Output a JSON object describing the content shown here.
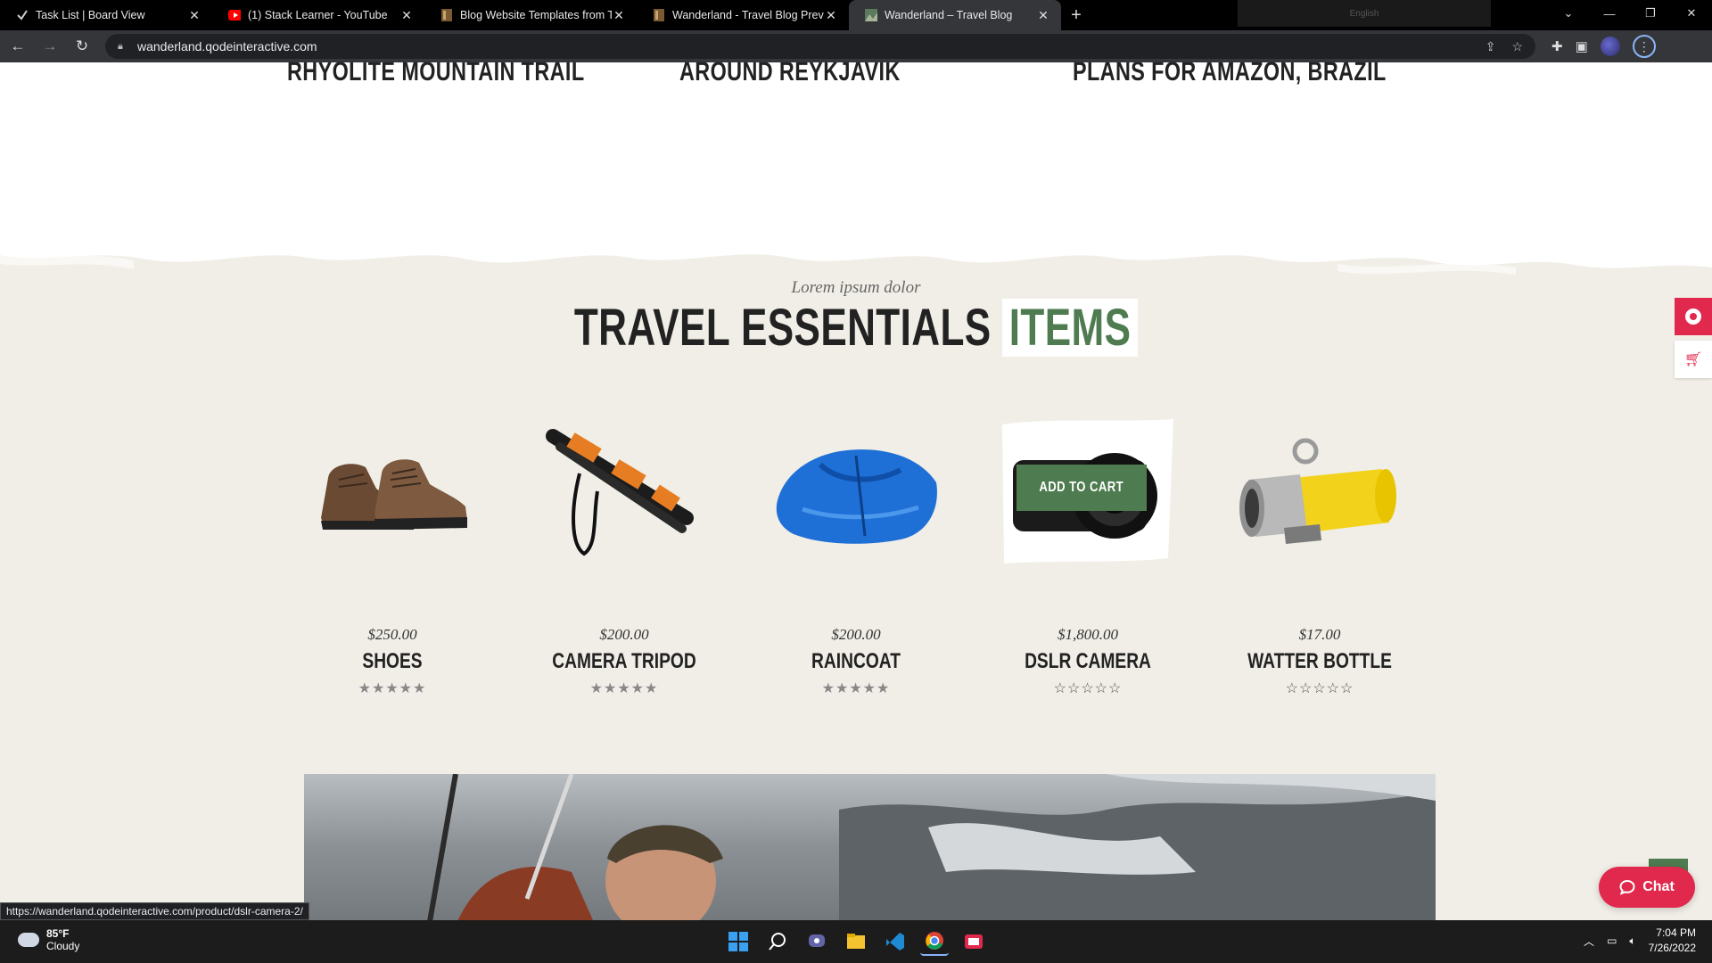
{
  "tabs": [
    {
      "title": "Task List | Board View",
      "icon": "check-icon"
    },
    {
      "title": "(1) Stack Learner - YouTube",
      "icon": "youtube-icon"
    },
    {
      "title": "Blog Website Templates from The",
      "icon": "bookmark-icon"
    },
    {
      "title": "Wanderland - Travel Blog Preview",
      "icon": "bookmark-icon"
    },
    {
      "title": "Wanderland – Travel Blog",
      "icon": "site-icon",
      "active": true
    }
  ],
  "extension_label": "English",
  "url": "wanderland.qodeinteractive.com",
  "status_url": "https://wanderland.qodeinteractive.com/product/dslr-camera-2/",
  "blog_posts": [
    {
      "title": "RHYOLITE MOUNTAIN TRAIL"
    },
    {
      "title": "AROUND REYKJAVIK"
    },
    {
      "title": "PLANS FOR AMAZON, BRAZIL"
    }
  ],
  "section": {
    "eyebrow": "Lorem ipsum dolor",
    "heading_main": "TRAVEL ESSENTIALS",
    "heading_accent": "ITEMS"
  },
  "products": [
    {
      "name": "SHOES",
      "price": "$250.00",
      "rating": 5,
      "stars": "★★★★★"
    },
    {
      "name": "CAMERA TRIPOD",
      "price": "$200.00",
      "rating": 5,
      "stars": "★★★★★"
    },
    {
      "name": "RAINCOAT",
      "price": "$200.00",
      "rating": 5,
      "stars": "★★★★★"
    },
    {
      "name": "DSLR CAMERA",
      "price": "$1,800.00",
      "rating": 0,
      "stars": "☆☆☆☆☆",
      "hover_button": "ADD TO CART"
    },
    {
      "name": "WATTER BOTTLE",
      "price": "$17.00",
      "rating": 0,
      "stars": "☆☆☆☆☆"
    }
  ],
  "chat_label": "Chat",
  "taskbar": {
    "weather_temp": "85°F",
    "weather_desc": "Cloudy",
    "time": "7:04 PM",
    "date": "7/26/2022"
  },
  "colors": {
    "accent_green": "#4e7b4f",
    "accent_red": "#e0294c",
    "page_bg": "#f0eee6"
  }
}
